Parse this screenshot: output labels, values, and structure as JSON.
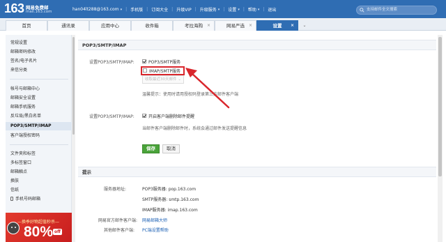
{
  "header": {
    "logo_number": "163",
    "logo_title": "网易免费邮",
    "logo_domain": "mail.163.com",
    "account": "han04lt288@163.com",
    "links": [
      "手机版",
      "订阅大全",
      "升级VIP",
      "升级服务",
      "设置",
      "帮助",
      "退出"
    ],
    "search_placeholder": "支持邮件全文搜索"
  },
  "tabs": [
    {
      "label": "首页",
      "closable": false,
      "active": false
    },
    {
      "label": "通讯录",
      "closable": false,
      "active": false
    },
    {
      "label": "应用中心",
      "closable": false,
      "active": false
    },
    {
      "label": "收件箱",
      "closable": false,
      "active": false
    },
    {
      "label": "考拉海购",
      "closable": true,
      "active": false
    },
    {
      "label": "网易严选",
      "closable": true,
      "active": false
    },
    {
      "label": "设置",
      "closable": true,
      "active": true
    }
  ],
  "sidebar": {
    "group1": [
      "常规设置",
      "邮箱密码修改",
      "签名/电子名片",
      "来信分类"
    ],
    "group2": [
      "帐号与邮箱中心",
      "邮箱安全设置",
      "邮箱手机服务",
      "反垃圾/黑白名单",
      "POP3/SMTP/IMAP",
      "客户端授权密码"
    ],
    "group3": [
      "文件夹和标签",
      "多标签窗口",
      "邮箱触点",
      "换肤",
      "信纸",
      "手机号码邮箱"
    ],
    "active": "POP3/SMTP/IMAP"
  },
  "promo": {
    "text": "—换季好物超值秒杀—",
    "big": "80%",
    "off": "off"
  },
  "settings": {
    "section_title": "POP3/SMTP/IMAP",
    "label1": "设置POP3/SMTP/IMAP:",
    "pop3_label": "POP3/SMTP服务",
    "pop3_checked": true,
    "imap_label": "IMAP/SMTP服务",
    "imap_checked": false,
    "dropdown_value": "收取最近30天邮件",
    "tip": "温馨提示：使用时请用授权码登录第三方邮件客户端",
    "label2": "设置POP3/SMTP/IMAP:",
    "delete_label": "开启客户端删除邮件提醒",
    "delete_checked": true,
    "delete_desc": "当邮件客户端删除邮件时，系统会通过邮件发送提醒信息",
    "save_label": "保存",
    "cancel_label": "取消"
  },
  "hints": {
    "section_title": "提示",
    "server_label": "服务器地址:",
    "pop3_server": "POP3服务器: pop.163.com",
    "smtp_server": "SMTP服务器: smtp.163.com",
    "imap_server": "IMAP服务器: imap.163.com",
    "official_label": "网易官方邮件客户端:",
    "official_link": "网易邮箱大师",
    "other_label": "其他邮件客户端:",
    "other_link": "PC端设置帮助"
  },
  "colors": {
    "brand": "#2f6db3",
    "highlight": "#d9262c",
    "save": "#4aa33a"
  }
}
